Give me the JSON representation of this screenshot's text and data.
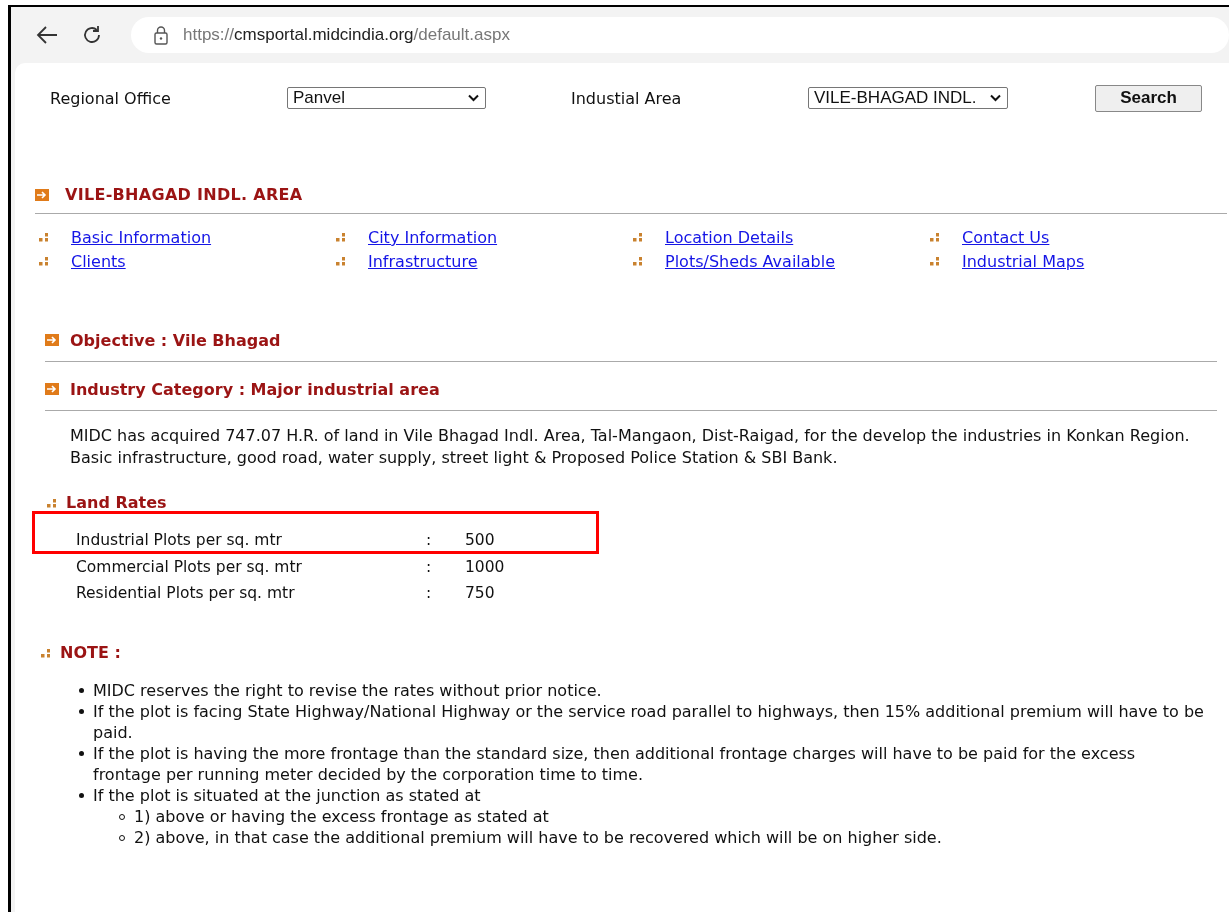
{
  "browser": {
    "url_parts": [
      {
        "text": "https://",
        "dim": true
      },
      {
        "text": "cmsportal.midcindia.org",
        "dim": false
      },
      {
        "text": "/default.aspx",
        "dim": true
      }
    ]
  },
  "filters": [
    {
      "label": "Regional Office",
      "value": "Panvel"
    },
    {
      "label": "Industial Area",
      "value": "VILE-BHAGAD INDL."
    }
  ],
  "search_button": "Search",
  "area_title": "VILE-BHAGAD INDL. AREA",
  "links": [
    "Basic Information",
    "City Information",
    "Location Details",
    "Contact Us",
    "Clients",
    "Infrastructure",
    "Plots/Sheds Available",
    "Industrial Maps"
  ],
  "headings": [
    "Objective : Vile Bhagad",
    "Industry Category : Major industrial area"
  ],
  "description": "MIDC has acquired 747.07 H.R. of land in Vile Bhagad Indl. Area, Tal-Mangaon, Dist-Raigad, for the develop the industries in Konkan Region. Basic infrastructure, good road, water supply, street light & Proposed Police Station & SBI Bank.",
  "land_rates": {
    "title": "Land Rates",
    "rows": [
      {
        "label": "Industrial Plots per sq. mtr",
        "separator": ":",
        "value": "500",
        "highlighted": true
      },
      {
        "label": "Commercial Plots per sq. mtr",
        "separator": ":",
        "value": "1000",
        "highlighted": false
      },
      {
        "label": "Residential Plots per sq. mtr",
        "separator": ":",
        "value": "750",
        "highlighted": false
      }
    ]
  },
  "note": {
    "title": "NOTE :",
    "items": [
      {
        "text": "MIDC reserves the right to revise the rates without prior notice."
      },
      {
        "text": "If the plot is facing State Highway/National Highway or the service road parallel to highways, then 15% additional premium will have to be paid."
      },
      {
        "text": "If the plot is having the more frontage than the standard size, then additional frontage charges will have to be paid for the excess frontage per running meter decided by the corporation time to time."
      },
      {
        "text": "If the plot is situated at the junction as stated at",
        "children": [
          {
            "text": "1) above or having the excess frontage as stated at"
          },
          {
            "text": "2) above, in that case the additional premium will have to be recovered which will be on higher side."
          }
        ]
      }
    ]
  }
}
